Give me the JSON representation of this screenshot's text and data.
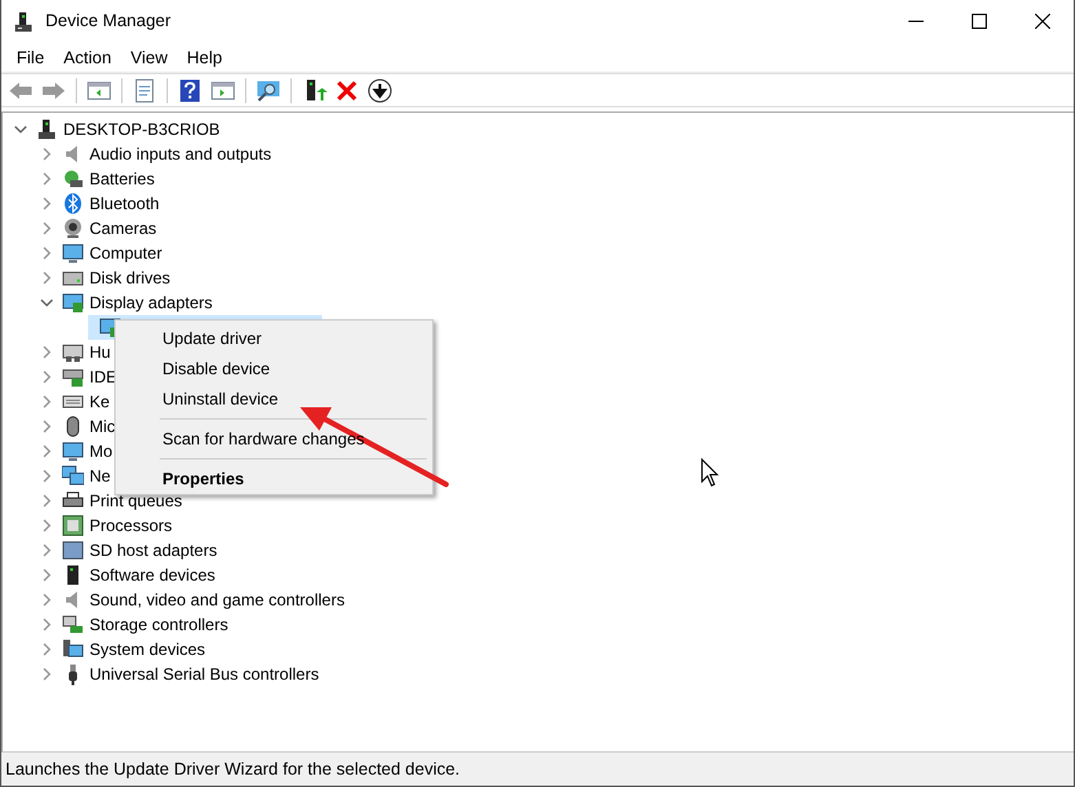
{
  "window": {
    "title": "Device Manager"
  },
  "menu_bar": [
    "File",
    "Action",
    "View",
    "Help"
  ],
  "tree": {
    "label": "DESKTOP-B3CRIOB",
    "expanded": true,
    "children": [
      {
        "label": "Audio inputs and outputs",
        "expanded": false
      },
      {
        "label": "Batteries",
        "expanded": false
      },
      {
        "label": "Bluetooth",
        "expanded": false
      },
      {
        "label": "Cameras",
        "expanded": false
      },
      {
        "label": "Computer",
        "expanded": false
      },
      {
        "label": "Disk drives",
        "expanded": false
      },
      {
        "label": "Display adapters",
        "expanded": true,
        "children": [
          {
            "selected": true
          }
        ]
      },
      {
        "label": "Hu",
        "expanded": false
      },
      {
        "label": "IDE",
        "expanded": false
      },
      {
        "label": "Ke",
        "expanded": false
      },
      {
        "label": "Mic",
        "expanded": false
      },
      {
        "label": "Mo",
        "expanded": false
      },
      {
        "label": "Ne",
        "expanded": false
      },
      {
        "label": "Print queues",
        "expanded": false
      },
      {
        "label": "Processors",
        "expanded": false
      },
      {
        "label": "SD host adapters",
        "expanded": false
      },
      {
        "label": "Software devices",
        "expanded": false
      },
      {
        "label": "Sound, video and game controllers",
        "expanded": false
      },
      {
        "label": "Storage controllers",
        "expanded": false
      },
      {
        "label": "System devices",
        "expanded": false
      },
      {
        "label": "Universal Serial Bus controllers",
        "expanded": false
      }
    ]
  },
  "context_menu": [
    {
      "kind": "item",
      "label": "Update driver",
      "bold": false
    },
    {
      "kind": "item",
      "label": "Disable device",
      "bold": false
    },
    {
      "kind": "item",
      "label": "Uninstall device",
      "bold": false
    },
    {
      "kind": "separator"
    },
    {
      "kind": "item",
      "label": "Scan for hardware changes",
      "bold": false
    },
    {
      "kind": "separator"
    },
    {
      "kind": "item",
      "label": "Properties",
      "bold": true
    }
  ],
  "status_bar": "Launches the Update Driver Wizard for the selected device."
}
